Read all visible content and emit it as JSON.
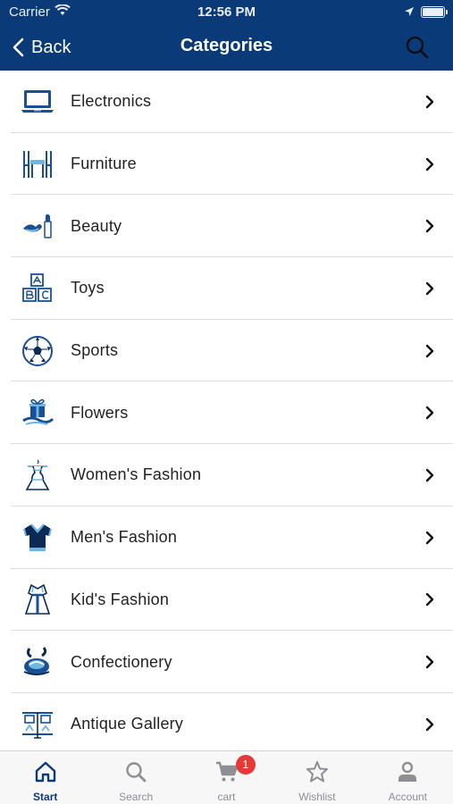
{
  "status_bar": {
    "carrier": "Carrier",
    "time": "12:56 PM"
  },
  "header": {
    "back_label": "Back",
    "title": "Categories"
  },
  "colors": {
    "header_bg": "#0a3a78",
    "icon_blue": "#1b4f93",
    "icon_light": "#6fb7e3",
    "badge": "#e53935"
  },
  "categories": [
    {
      "label": "Electronics",
      "icon": "laptop-icon"
    },
    {
      "label": "Furniture",
      "icon": "chairs-icon"
    },
    {
      "label": "Beauty",
      "icon": "lipstick-icon"
    },
    {
      "label": "Toys",
      "icon": "toy-blocks-icon"
    },
    {
      "label": "Sports",
      "icon": "soccer-ball-icon"
    },
    {
      "label": "Flowers",
      "icon": "gift-flowers-icon"
    },
    {
      "label": "Women's Fashion",
      "icon": "dress-icon"
    },
    {
      "label": "Men's Fashion",
      "icon": "shirt-icon"
    },
    {
      "label": "Kid's Fashion",
      "icon": "kids-dress-icon"
    },
    {
      "label": "Confectionery",
      "icon": "candy-icon"
    },
    {
      "label": "Antique Gallery",
      "icon": "gallery-icon"
    }
  ],
  "tabbar": {
    "tabs": [
      {
        "label": "Start",
        "icon": "home-icon",
        "active": true
      },
      {
        "label": "Search",
        "icon": "search-icon",
        "active": false
      },
      {
        "label": "cart",
        "icon": "cart-icon",
        "active": false,
        "badge": "1"
      },
      {
        "label": "Wishlist",
        "icon": "star-icon",
        "active": false
      },
      {
        "label": "Account",
        "icon": "user-icon",
        "active": false
      }
    ]
  }
}
